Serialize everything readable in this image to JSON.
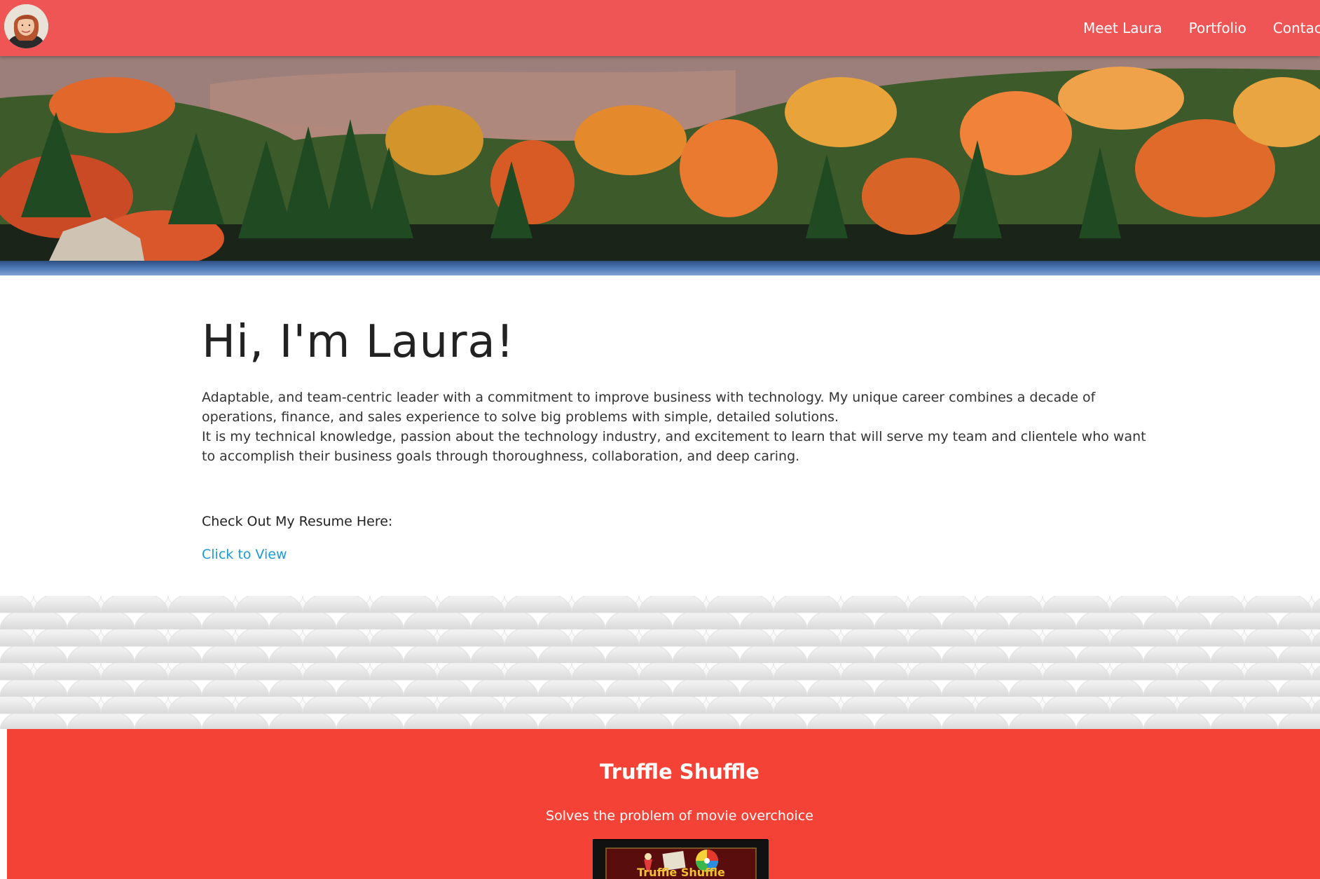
{
  "nav": {
    "avatar_alt": "Laura",
    "links": [
      {
        "label": "Meet Laura"
      },
      {
        "label": "Portfolio"
      },
      {
        "label": "Contact M"
      }
    ]
  },
  "intro": {
    "heading": "Hi, I'm Laura!",
    "bio_line1": "Adaptable, and team-centric leader with a commitment to improve business with technology. My unique career combines a decade of operations, finance, and sales experience to solve big problems with simple, detailed solutions.",
    "bio_line2": "It is my technical knowledge, passion about the technology industry, and excitement to learn that will serve my team and clientele who want to accomplish their business goals through thoroughness, collaboration, and deep caring.",
    "resume_label": "Check Out My Resume Here:",
    "resume_link": "Click to View"
  },
  "portfolio": {
    "project": {
      "title": "Truffle Shuffle",
      "description": "Solves the problem of movie overchoice",
      "thumb_text": "Truffle Shuffle"
    }
  },
  "colors": {
    "navbar": "#ef5555",
    "portfolio_bg": "#f44336",
    "link": "#1a9ad6",
    "heading": "#222222"
  }
}
